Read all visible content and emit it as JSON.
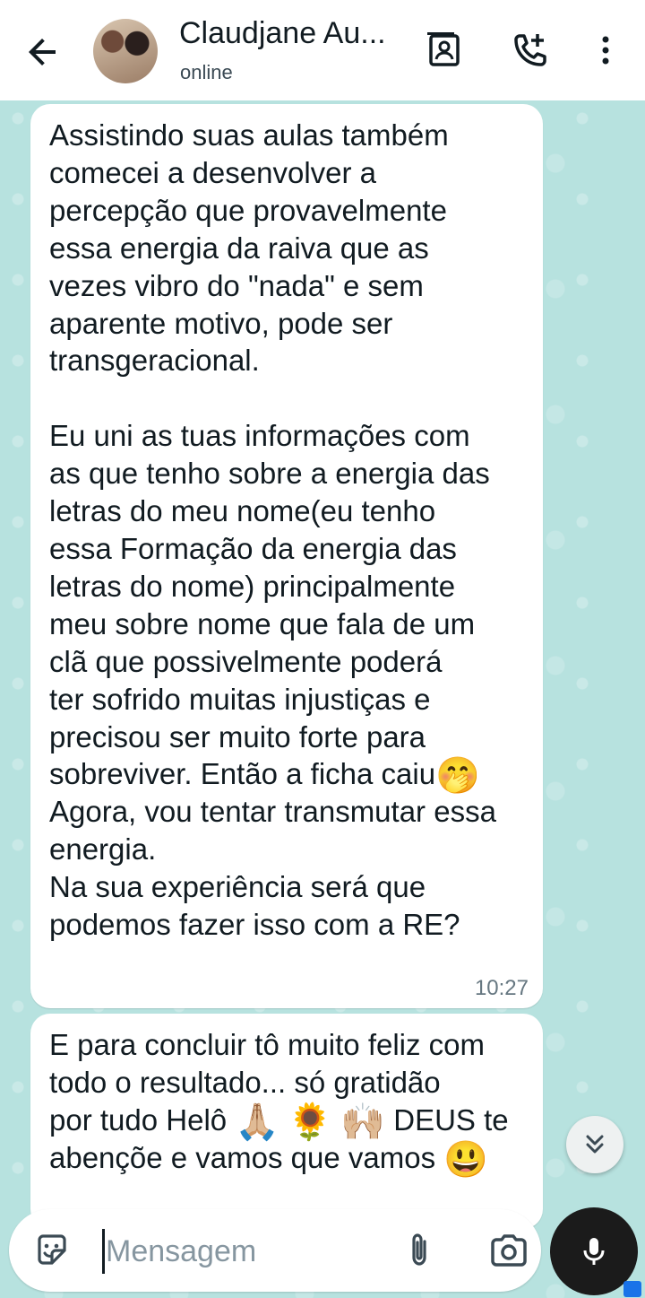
{
  "header": {
    "contact_name": "Claudjane Au...",
    "status": "online",
    "icons": [
      "back-arrow-icon",
      "avatar",
      "contact-card-icon",
      "add-call-icon",
      "more-vert-icon"
    ]
  },
  "messages": [
    {
      "parts": [
        "Assistindo suas aulas também\ncomecei a desenvolver a\npercepção que provavelmente\nessa energia da raiva que as\nvezes vibro do \"nada\" e sem\naparente motivo, pode ser\ntransgeracional.\n\nEu uni as tuas informações com\nas que tenho sobre a energia das\nletras do meu nome(eu tenho\nessa Formação da energia das\nletras do nome) principalmente\nmeu sobre nome que fala de um\nclã que possivelmente poderá\nter sofrido muitas injustiças e\nprecisou ser muito forte para\nsobreviver. Então a ficha caiu",
        "🤭",
        "\nAgora, vou tentar transmutar essa\nenergia.\nNa sua experiência será que\npodemos fazer isso com a RE?"
      ],
      "time": "10:27"
    },
    {
      "parts": [
        "E para concluir tô muito feliz com\ntodo o resultado... só gratidão\npor tudo Helô ",
        "🙏🏼",
        " ",
        "🌻",
        " ",
        "🙌🏼",
        " DEUS te\nabençõe e vamos que vamos ",
        "😃"
      ]
    }
  ],
  "composer": {
    "placeholder": "Mensagem",
    "value": ""
  },
  "colors": {
    "wallpaper": "#b7e2df",
    "bubble": "#ffffff",
    "text": "#111b21",
    "time": "#667781",
    "mic_button": "#1b1b1b"
  }
}
